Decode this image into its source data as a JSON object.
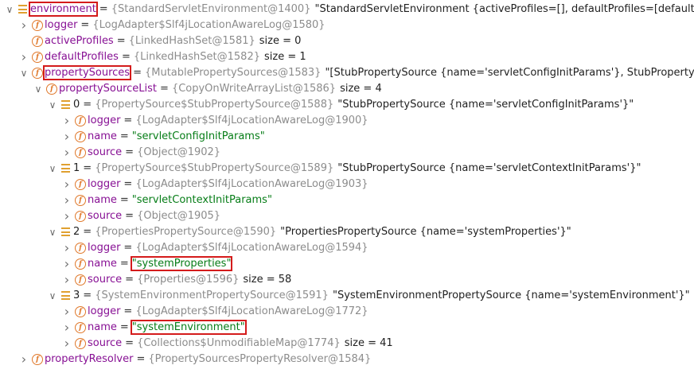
{
  "colors": {
    "field": "#871094",
    "type_ref": "#8c8c8c",
    "string": "#067d17",
    "plain": "#1f1f1f",
    "field_icon": "#e0782a",
    "list_icon": "#e0a030",
    "highlight_border": "#d41b1b"
  },
  "rows": [
    {
      "arrow": "expanded",
      "icon": "list-icon",
      "name": "environment",
      "type": "{StandardServletEnvironment@1400}",
      "value": "\"StandardServletEnvironment {activeProfiles=[], defaultProfiles=[default], prope",
      "value_kind": "plain",
      "highlight": "name"
    },
    {
      "arrow": "collapsed",
      "icon": "field-icon",
      "name": "logger",
      "type": "{LogAdapter$Slf4jLocationAwareLog@1580}",
      "value": "",
      "value_kind": "plain"
    },
    {
      "arrow": "none",
      "icon": "field-icon",
      "name": "activeProfiles",
      "type": "{LinkedHashSet@1581}",
      "value": "size = 0",
      "value_kind": "plain"
    },
    {
      "arrow": "collapsed",
      "icon": "field-icon",
      "name": "defaultProfiles",
      "type": "{LinkedHashSet@1582}",
      "value": "size = 1",
      "value_kind": "plain"
    },
    {
      "arrow": "expanded",
      "icon": "field-icon",
      "name": "propertySources",
      "type": "{MutablePropertySources@1583}",
      "value": "\"[StubPropertySource {name='servletConfigInitParams'}, StubPropertySource",
      "value_kind": "plain",
      "highlight": "name"
    },
    {
      "arrow": "expanded",
      "icon": "field-icon",
      "name": "propertySourceList",
      "type": "{CopyOnWriteArrayList@1586}",
      "value": "size = 4",
      "value_kind": "plain"
    },
    {
      "arrow": "expanded",
      "icon": "list-icon",
      "name": "0",
      "type": "{PropertySource$StubPropertySource@1588}",
      "value": "\"StubPropertySource {name='servletConfigInitParams'}\"",
      "value_kind": "plain",
      "name_kind": "plain"
    },
    {
      "arrow": "collapsed",
      "icon": "field-icon",
      "name": "logger",
      "type": "{LogAdapter$Slf4jLocationAwareLog@1900}",
      "value": "",
      "value_kind": "plain"
    },
    {
      "arrow": "collapsed",
      "icon": "field-icon",
      "name": "name",
      "type": "",
      "value": "\"servletConfigInitParams\"",
      "value_kind": "string"
    },
    {
      "arrow": "collapsed",
      "icon": "field-icon",
      "name": "source",
      "type": "{Object@1902}",
      "value": "",
      "value_kind": "plain"
    },
    {
      "arrow": "expanded",
      "icon": "list-icon",
      "name": "1",
      "type": "{PropertySource$StubPropertySource@1589}",
      "value": "\"StubPropertySource {name='servletContextInitParams'}\"",
      "value_kind": "plain",
      "name_kind": "plain"
    },
    {
      "arrow": "collapsed",
      "icon": "field-icon",
      "name": "logger",
      "type": "{LogAdapter$Slf4jLocationAwareLog@1903}",
      "value": "",
      "value_kind": "plain"
    },
    {
      "arrow": "collapsed",
      "icon": "field-icon",
      "name": "name",
      "type": "",
      "value": "\"servletContextInitParams\"",
      "value_kind": "string"
    },
    {
      "arrow": "collapsed",
      "icon": "field-icon",
      "name": "source",
      "type": "{Object@1905}",
      "value": "",
      "value_kind": "plain"
    },
    {
      "arrow": "expanded",
      "icon": "list-icon",
      "name": "2",
      "type": "{PropertiesPropertySource@1590}",
      "value": "\"PropertiesPropertySource {name='systemProperties'}\"",
      "value_kind": "plain",
      "name_kind": "plain"
    },
    {
      "arrow": "collapsed",
      "icon": "field-icon",
      "name": "logger",
      "type": "{LogAdapter$Slf4jLocationAwareLog@1594}",
      "value": "",
      "value_kind": "plain"
    },
    {
      "arrow": "collapsed",
      "icon": "field-icon",
      "name": "name",
      "type": "",
      "value": "\"systemProperties\"",
      "value_kind": "string",
      "highlight": "value"
    },
    {
      "arrow": "collapsed",
      "icon": "field-icon",
      "name": "source",
      "type": "{Properties@1596}",
      "value": "size = 58",
      "value_kind": "plain"
    },
    {
      "arrow": "expanded",
      "icon": "list-icon",
      "name": "3",
      "type": "{SystemEnvironmentPropertySource@1591}",
      "value": "\"SystemEnvironmentPropertySource {name='systemEnvironment'}\"",
      "value_kind": "plain",
      "name_kind": "plain"
    },
    {
      "arrow": "collapsed",
      "icon": "field-icon",
      "name": "logger",
      "type": "{LogAdapter$Slf4jLocationAwareLog@1772}",
      "value": "",
      "value_kind": "plain"
    },
    {
      "arrow": "collapsed",
      "icon": "field-icon",
      "name": "name",
      "type": "",
      "value": "\"systemEnvironment\"",
      "value_kind": "string",
      "highlight": "value"
    },
    {
      "arrow": "collapsed",
      "icon": "field-icon",
      "name": "source",
      "type": "{Collections$UnmodifiableMap@1774}",
      "value": "size = 41",
      "value_kind": "plain"
    },
    {
      "arrow": "collapsed",
      "icon": "field-icon",
      "name": "propertyResolver",
      "type": "{PropertySourcesPropertyResolver@1584}",
      "value": "",
      "value_kind": "plain"
    }
  ],
  "equals_sign": "="
}
